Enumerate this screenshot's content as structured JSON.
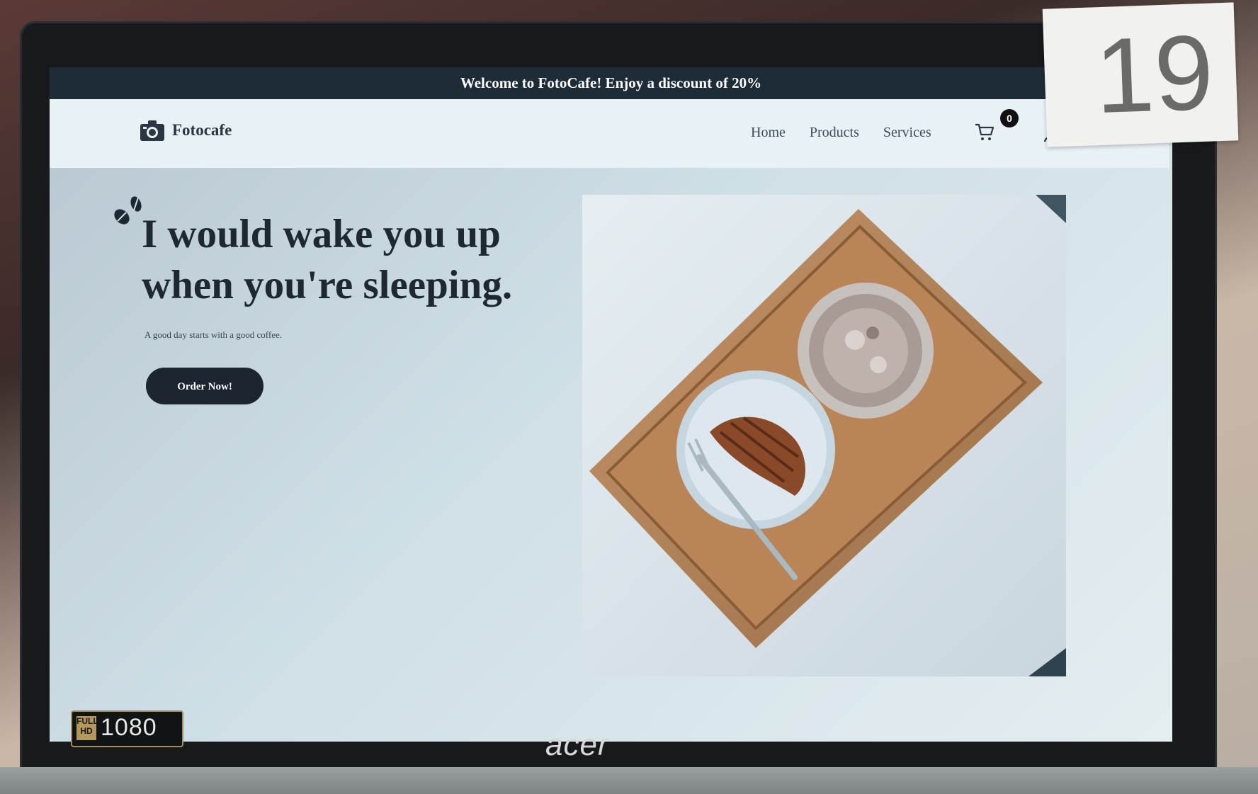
{
  "announcement": "Welcome to FotoCafe! Enjoy a discount of 20%",
  "logo": {
    "text": "Fotocafe",
    "icon": "camera-icon"
  },
  "nav": {
    "links": [
      "Home",
      "Products",
      "Services"
    ],
    "cart_count": "0",
    "cart_icon": "cart-icon",
    "user_icon": "user-icon"
  },
  "hero": {
    "headline_line1": "I would wake you up",
    "headline_line2": "when you're sleeping.",
    "tagline": "A good day starts with a good coffee.",
    "cta_label": "Order Now!",
    "decor_icon": "coffee-beans-icon",
    "image": "tray-with-croissant-and-iced-coffee-photo"
  },
  "photo_sticker": "19",
  "laptop": {
    "brand": "acer",
    "badge_small": "FULL HD",
    "badge_number": "1080"
  },
  "colors": {
    "announcement_bg": "#1d2c37",
    "nav_bg": "#e8f2f6",
    "button_bg": "#1b2530",
    "text_dark": "#1d2832"
  }
}
